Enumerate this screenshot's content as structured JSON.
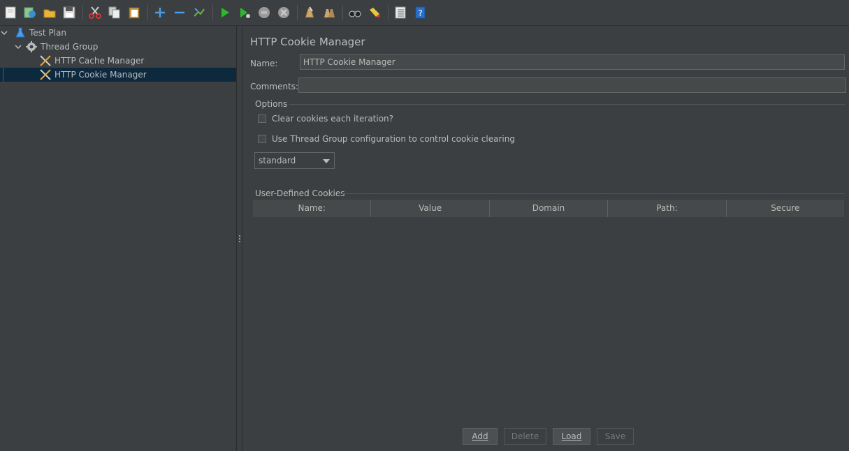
{
  "toolbar": {
    "buttons": [
      "new-icon",
      "templates-icon",
      "open-icon",
      "save-icon",
      "cut-icon",
      "copy-icon",
      "paste-icon",
      "expand-icon",
      "collapse-icon",
      "toggle-icon",
      "start-icon",
      "start-no-pauses-icon",
      "stop-icon",
      "shutdown-icon",
      "clear-icon",
      "clear-all-icon",
      "search-icon",
      "reset-search-icon",
      "function-helper-icon",
      "help-icon"
    ]
  },
  "tree": {
    "items": [
      {
        "label": "Test Plan",
        "icon": "flask-icon"
      },
      {
        "label": "Thread Group",
        "icon": "gear-icon"
      },
      {
        "label": "HTTP Cache Manager",
        "icon": "tools-icon"
      },
      {
        "label": "HTTP Cookie Manager",
        "icon": "tools-icon",
        "selected": true
      }
    ]
  },
  "panel": {
    "title": "HTTP Cookie Manager",
    "name_label": "Name:",
    "name_value": "HTTP Cookie Manager",
    "comments_label": "Comments:",
    "comments_value": "",
    "options_title": "Options",
    "clear_cookies_label": "Clear cookies each iteration?",
    "clear_cookies_checked": false,
    "thread_group_config_label": "Use Thread Group configuration to control cookie clearing",
    "thread_group_config_checked": false,
    "policy_selected": "standard",
    "cookies_title": "User-Defined Cookies",
    "columns": [
      "Name:",
      "Value",
      "Domain",
      "Path:",
      "Secure"
    ]
  },
  "buttons": {
    "add": "Add",
    "delete": "Delete",
    "load": "Load",
    "save": "Save"
  },
  "colors": {
    "background": "#3c3f41",
    "selection": "#0d293e",
    "text": "#bbbbbb"
  }
}
